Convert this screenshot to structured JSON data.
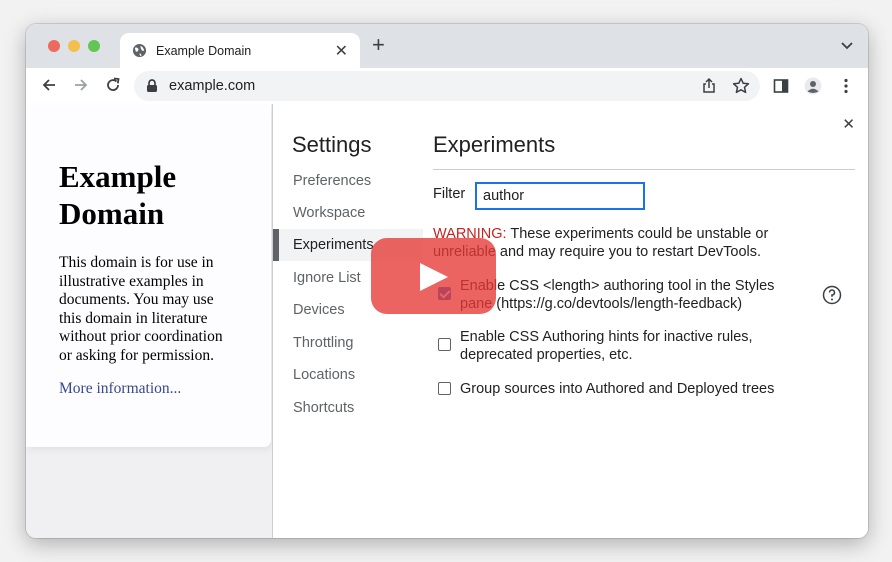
{
  "browser": {
    "tab": {
      "title": "Example Domain",
      "close_glyph": "✕"
    },
    "new_tab_glyph": "+",
    "address": {
      "url": "example.com"
    },
    "icons": [
      "back-icon",
      "forward-icon",
      "reload-icon",
      "lock-icon",
      "share-icon",
      "bookmark-star-icon",
      "side-panel-icon",
      "profile-icon",
      "more-menu-icon",
      "tab-search-icon"
    ]
  },
  "site": {
    "heading": "Example Domain",
    "paragraph": "This domain is for use in illustrative examples in documents. You may use this domain in literature without prior coordination or asking for permission.",
    "link": "More information..."
  },
  "devtools": {
    "close_glyph": "✕",
    "settings_title": "Settings",
    "nav": [
      {
        "label": "Preferences"
      },
      {
        "label": "Workspace"
      },
      {
        "label": "Experiments",
        "selected": true
      },
      {
        "label": "Ignore List"
      },
      {
        "label": "Devices"
      },
      {
        "label": "Throttling"
      },
      {
        "label": "Locations"
      },
      {
        "label": "Shortcuts"
      }
    ],
    "experiments": {
      "title": "Experiments",
      "filter_label": "Filter",
      "filter_value": "author",
      "warning_prefix": "WARNING:",
      "warning_text": " These experiments could be unstable or unreliable and may require you to restart DevTools.",
      "items": [
        {
          "label": "Enable CSS <length> authoring tool in the Styles pane (https://g.co/devtools/length-feedback)",
          "checked": true,
          "has_help": true
        },
        {
          "label": "Enable CSS Authoring hints for inactive rules, deprecated properties, etc.",
          "checked": false
        },
        {
          "label": "Group sources into Authored and Deployed trees",
          "checked": false
        }
      ]
    }
  },
  "overlay": {
    "icon": "play-icon",
    "color": "#e63834"
  },
  "colors": {
    "accent": "#1a73e8",
    "warning": "#c5221f",
    "link": "#38488f"
  }
}
